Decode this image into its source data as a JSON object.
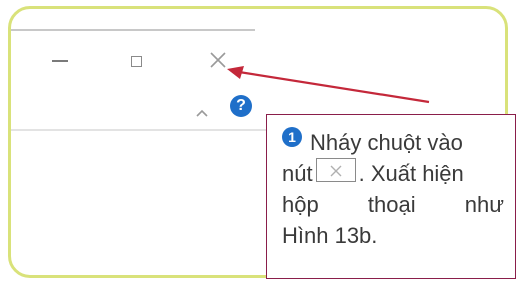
{
  "window_controls": {
    "minimize_icon": "minimize-icon",
    "maximize_icon": "maximize-icon",
    "close_icon": "close-icon"
  },
  "ribbon": {
    "collapse_icon": "chevron-up-icon",
    "help_label": "?"
  },
  "callout": {
    "step_number": "1",
    "line1": "Nháy chuột vào",
    "line2_before": "nút",
    "line2_after": ". Xuất hiện",
    "line3_words": [
      "hộp",
      "thoại",
      "như"
    ],
    "line4": "Hình 13b."
  },
  "colors": {
    "frame_border": "#d9e27a",
    "callout_border": "#8a1e4a",
    "arrow": "#c4283a",
    "help_blue": "#1f6fc9"
  }
}
